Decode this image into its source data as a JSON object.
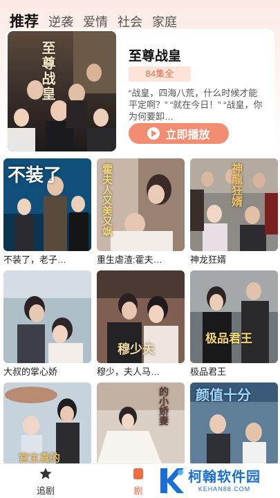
{
  "tabs": [
    {
      "label": "推荐",
      "active": true
    },
    {
      "label": "逆袭"
    },
    {
      "label": "爱情"
    },
    {
      "label": "社会"
    },
    {
      "label": "家庭"
    }
  ],
  "featured": {
    "title": "至尊战皇",
    "episodes": "84集全",
    "description": "“战皇，四海八荒，什么时候才能平定啊？” “就在今日！” “战皇，你为何要卸…",
    "play_label": "立即播放",
    "poster_text": "至尊战皇"
  },
  "dramas": [
    {
      "title": "不装了，老子…",
      "poster_text": "不装了"
    },
    {
      "title": "重生虐渣:霍夫…",
      "poster_text": "霍夫人又美又飒"
    },
    {
      "title": "神龙狂婿",
      "poster_text": "神龍狂婿"
    },
    {
      "title": "大叔的掌心娇",
      "poster_text": ""
    },
    {
      "title": "穆少，夫人马…",
      "poster_text": "穆少夫"
    },
    {
      "title": "极品君王",
      "poster_text": "极品君王"
    },
    {
      "title": "",
      "poster_text": "宫主真的"
    },
    {
      "title": "",
      "poster_text": "的小娇妻"
    },
    {
      "title": "",
      "poster_text": "颜值十分"
    }
  ],
  "bottom_nav": {
    "follow_label": "追剧",
    "theater_label": "剧"
  },
  "watermark": {
    "name": "柯翰软件园",
    "url": "KEHAN88.COM"
  },
  "colors": {
    "accent": "#f06a42",
    "play_button": "#f28d72",
    "badge_bg": "#fde4d9",
    "watermark_blue": "#1a6fd6"
  }
}
